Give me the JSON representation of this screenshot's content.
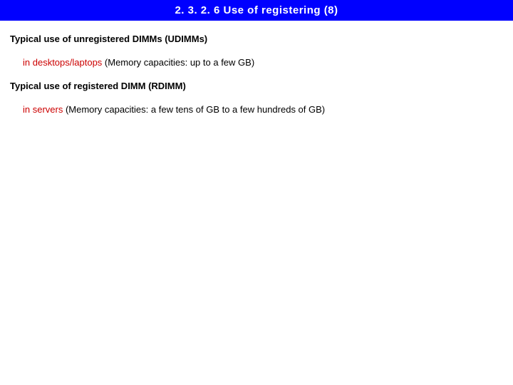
{
  "title": "2. 3. 2. 6  Use of registering (8)",
  "section1": {
    "heading": "Typical use of unregistered DIMMs (UDIMMs)",
    "redPart": "in desktops/laptops",
    "blackPart": " (Memory capacities: up to a few GB)"
  },
  "section2": {
    "heading": "Typical use of registered DIMM (RDIMM)",
    "redPart": "in servers ",
    "blackPart": " (Memory capacities: a few tens of GB to a few hundreds of GB)"
  }
}
